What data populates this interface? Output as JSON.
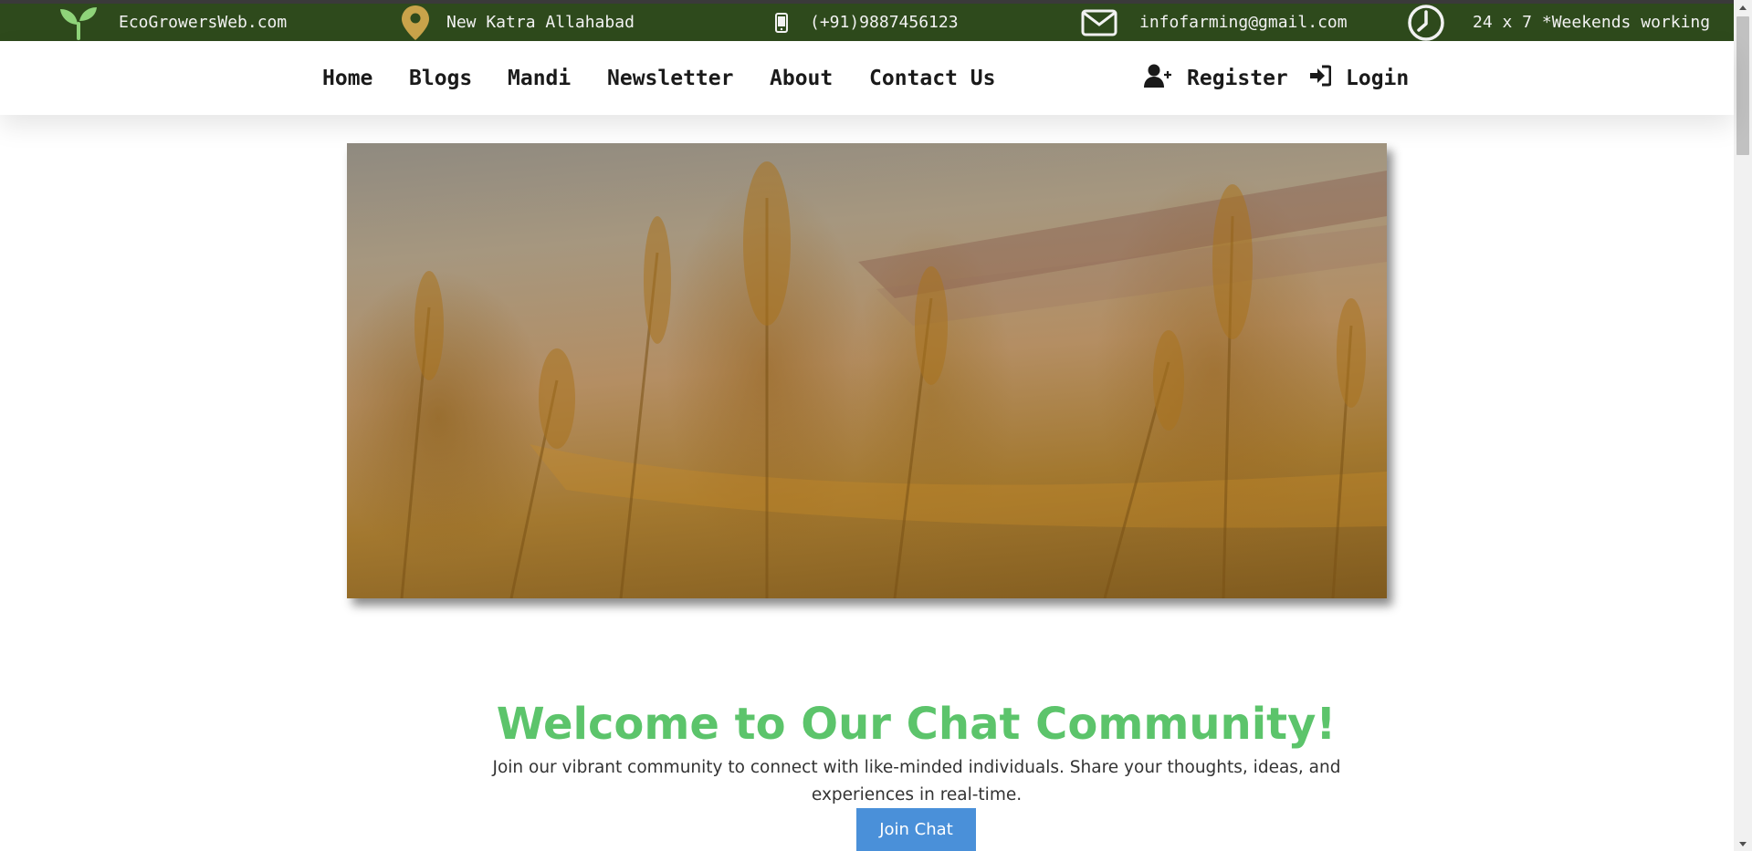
{
  "topbar": {
    "site": "EcoGrowersWeb.com",
    "location": "New Katra Allahabad",
    "phone": "(+91)9887456123",
    "email": "infofarming@gmail.com",
    "hours": "24 x 7 *Weekends working",
    "icons": [
      "sprout-icon",
      "location-pin-icon",
      "mobile-phone-icon",
      "envelope-icon",
      "clock-icon"
    ]
  },
  "nav": {
    "links": [
      "Home",
      "Blogs",
      "Mandi",
      "Newsletter",
      "About",
      "Contact Us"
    ],
    "register": "Register",
    "login": "Login"
  },
  "hero": {
    "image": "wheat-grain-harvest-image"
  },
  "welcome": {
    "title": "Welcome to Our Chat Community!",
    "text": "Join our vibrant community to connect with like-minded individuals. Share your thoughts, ideas, and experiences in real-time.",
    "button": "Join Chat"
  },
  "colors": {
    "topbar_bg": "#2e4a1c",
    "title_green": "#5cc46b",
    "button_blue": "#4a90d9",
    "pin_gold": "#c9a34a",
    "sprout_green": "#8fd47a"
  }
}
